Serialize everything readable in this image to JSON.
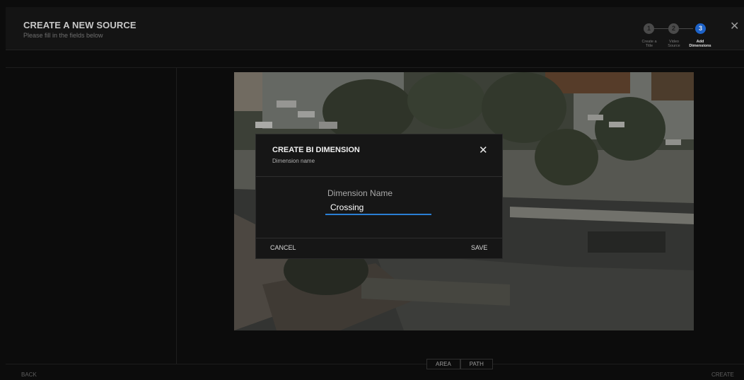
{
  "header": {
    "title": "CREATE A NEW SOURCE",
    "subtitle": "Please fill in the fields below",
    "close_symbol": "✕"
  },
  "steps": [
    {
      "number": "1",
      "label_line1": "Create a",
      "label_line2": "Title",
      "active": false
    },
    {
      "number": "2",
      "label_line1": "Video",
      "label_line2": "Source",
      "active": false
    },
    {
      "number": "3",
      "label_line1": "Add",
      "label_line2": "Dimensions",
      "active": true
    }
  ],
  "dialog": {
    "title": "CREATE BI DIMENSION",
    "subtitle": "Dimension name",
    "close_symbol": "✕",
    "field_label": "Dimension Name",
    "field_value": "Crossing",
    "cancel_label": "CANCEL",
    "save_label": "SAVE"
  },
  "tools": {
    "area_label": "AREA",
    "path_label": "PATH"
  },
  "footer": {
    "back_label": "BACK",
    "create_label": "CREATE"
  },
  "colors": {
    "accent": "#1d62c8",
    "input_underline": "#2a7fd4",
    "background": "#0c0c0c"
  },
  "icons": {
    "close": "close-icon",
    "video": "camera-feed-image"
  }
}
